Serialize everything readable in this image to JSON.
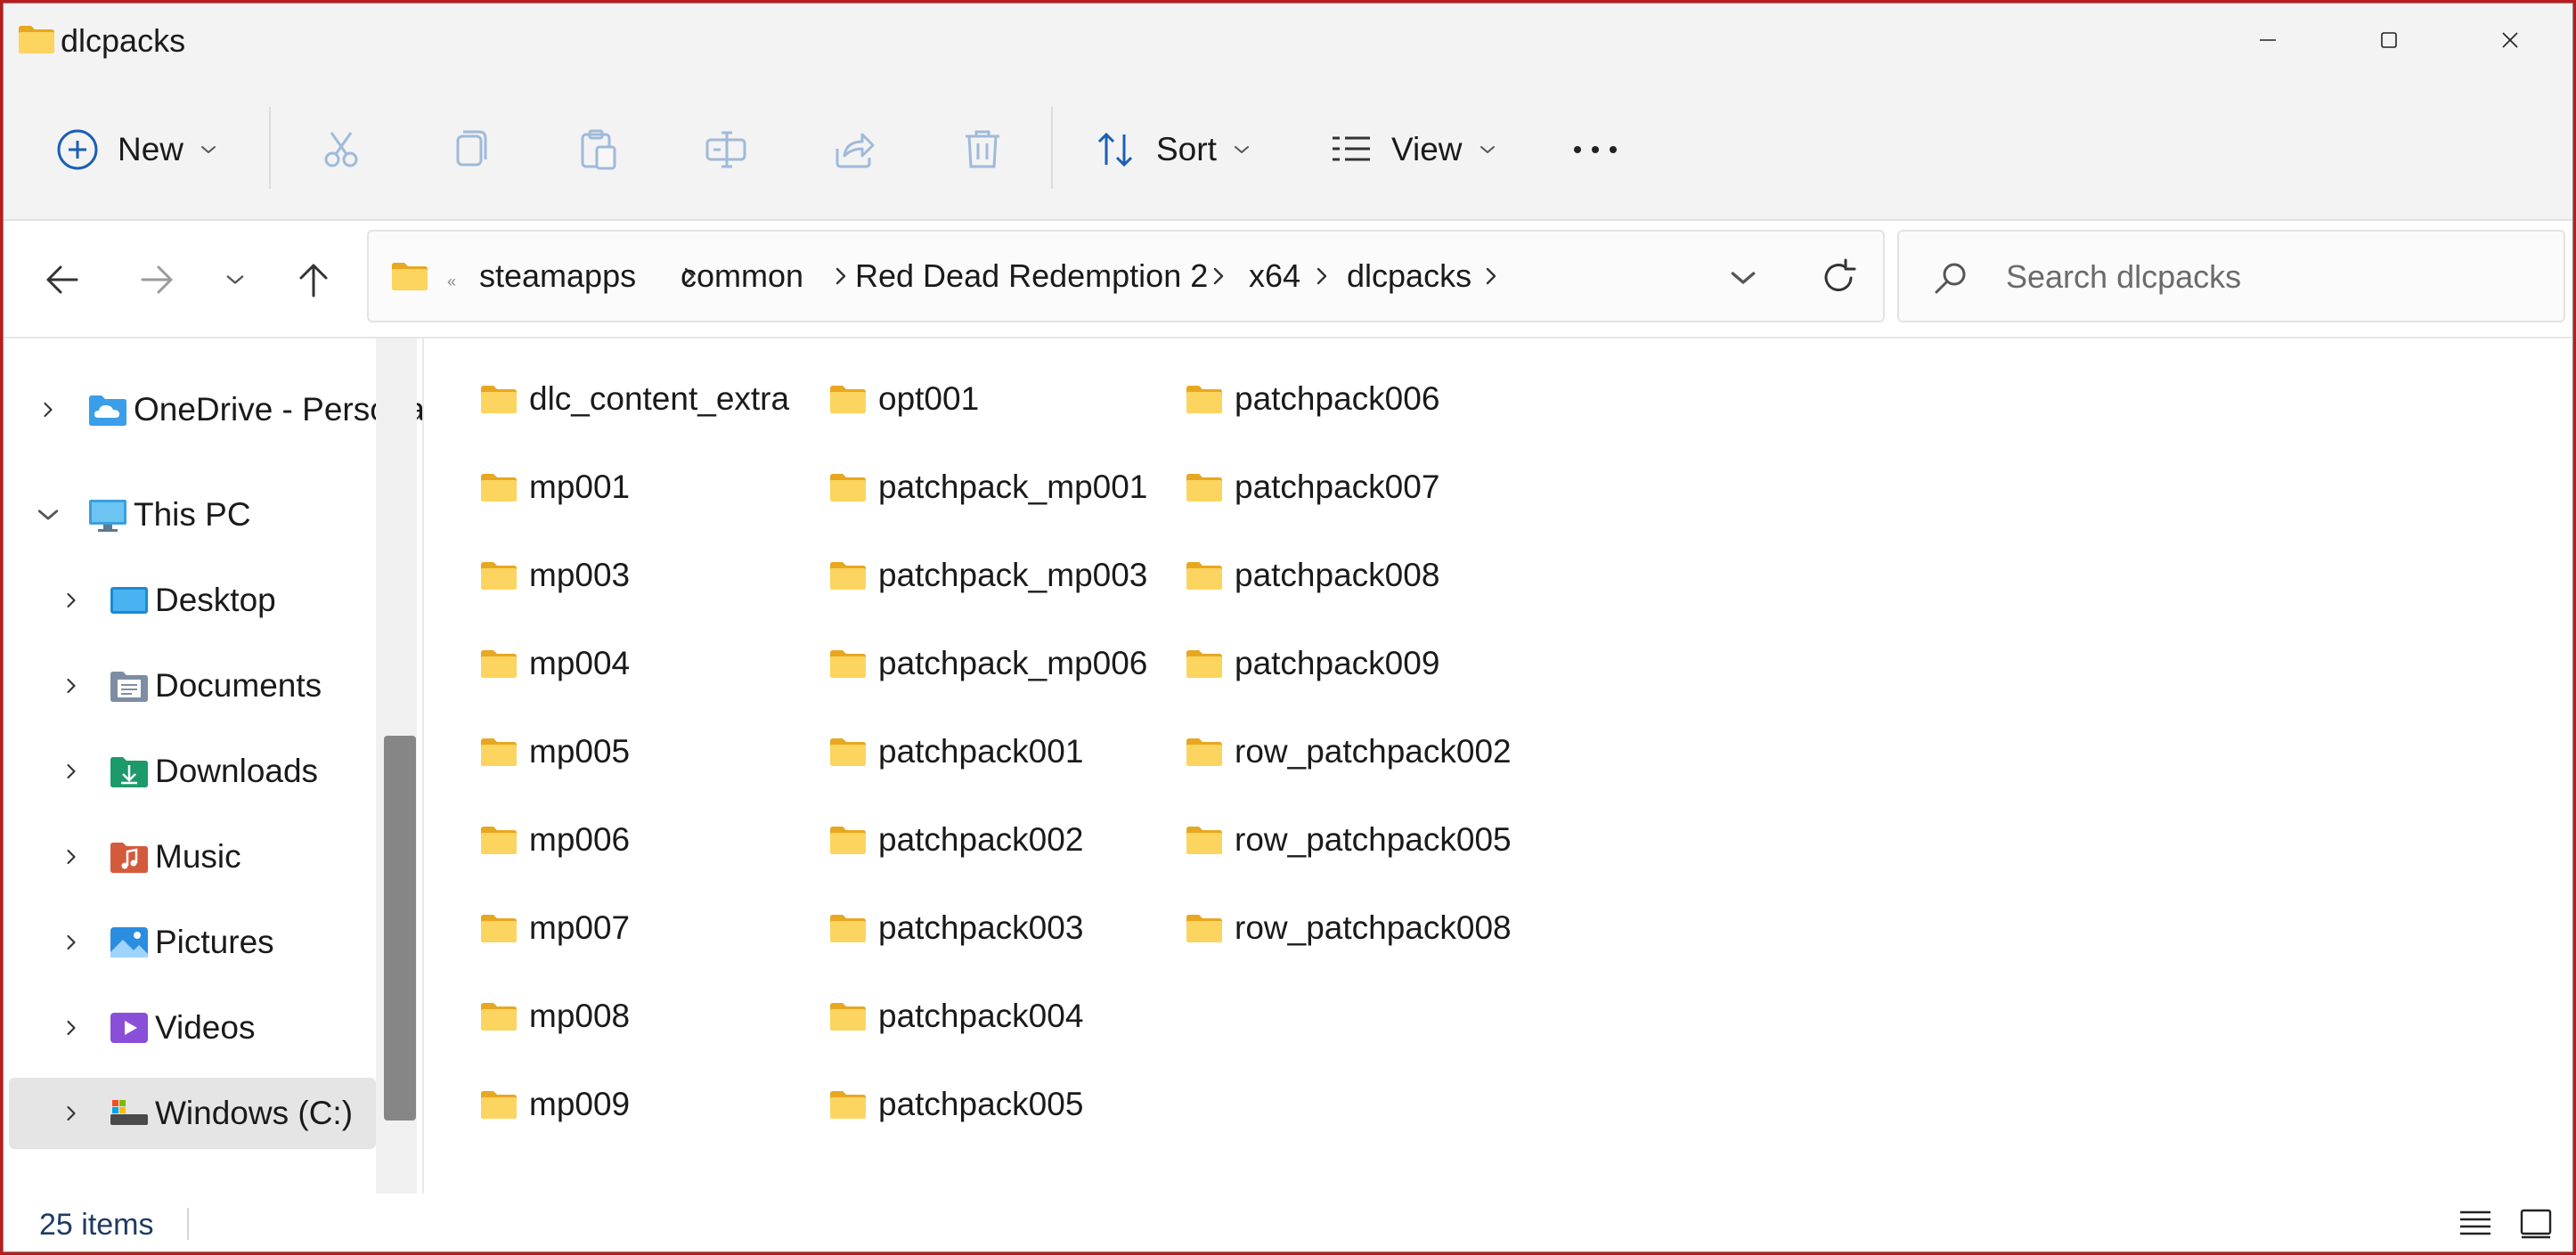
{
  "window": {
    "title": "dlcpacks",
    "controls": [
      "minimize-icon",
      "maximize-icon",
      "close-icon"
    ]
  },
  "commandbar": {
    "new_label": "New",
    "sort_label": "Sort",
    "view_label": "View",
    "icons": [
      "plus-circle-icon",
      "cut-icon",
      "copy-icon",
      "paste-icon",
      "rename-icon",
      "share-icon",
      "delete-icon",
      "sort-icon",
      "view-list-icon",
      "more-icon"
    ]
  },
  "address": {
    "overflow": "«",
    "crumbs": [
      "steamapps",
      "common",
      "Red Dead Redemption 2",
      "x64",
      "dlcpacks"
    ]
  },
  "search": {
    "placeholder": "Search dlcpacks"
  },
  "navpane": {
    "onedrive": "OneDrive - Personal",
    "this_pc": "This PC",
    "items": [
      {
        "label": "Desktop",
        "icon": "desktop-icon"
      },
      {
        "label": "Documents",
        "icon": "documents-icon"
      },
      {
        "label": "Downloads",
        "icon": "downloads-icon"
      },
      {
        "label": "Music",
        "icon": "music-icon"
      },
      {
        "label": "Pictures",
        "icon": "pictures-icon"
      },
      {
        "label": "Videos",
        "icon": "videos-icon"
      },
      {
        "label": "Windows (C:)",
        "icon": "drive-icon"
      }
    ]
  },
  "folders": {
    "col1": [
      "dlc_content_extra",
      "mp001",
      "mp003",
      "mp004",
      "mp005",
      "mp006",
      "mp007",
      "mp008",
      "mp009"
    ],
    "col2": [
      "opt001",
      "patchpack_mp001",
      "patchpack_mp003",
      "patchpack_mp006",
      "patchpack001",
      "patchpack002",
      "patchpack003",
      "patchpack004",
      "patchpack005"
    ],
    "col3": [
      "patchpack006",
      "patchpack007",
      "patchpack008",
      "patchpack009",
      "row_patchpack002",
      "row_patchpack005",
      "row_patchpack008"
    ]
  },
  "status": {
    "item_count": "25 items"
  },
  "colors": {
    "folder_yellow": "#f5c451",
    "accent": "#0067c0",
    "window_chrome": "#f3f3f3"
  }
}
